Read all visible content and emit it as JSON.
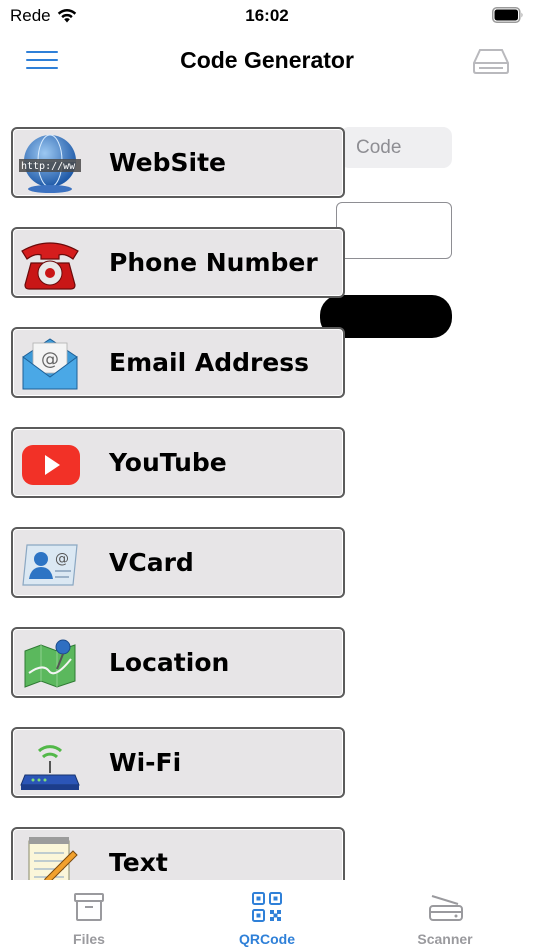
{
  "status_bar": {
    "carrier": "Rede",
    "time": "16:02"
  },
  "nav": {
    "title": "Code Generator",
    "left_icon": "hamburger-menu-icon",
    "right_icon": "drive-icon"
  },
  "background": {
    "segment_label": "Code"
  },
  "menu": {
    "items": [
      {
        "label": "WebSite",
        "icon": "globe-www-icon"
      },
      {
        "label": "Phone Number",
        "icon": "red-telephone-icon"
      },
      {
        "label": "Email Address",
        "icon": "envelope-at-icon"
      },
      {
        "label": "YouTube",
        "icon": "youtube-play-icon"
      },
      {
        "label": "VCard",
        "icon": "contact-card-icon"
      },
      {
        "label": "Location",
        "icon": "map-pin-icon"
      },
      {
        "label": "Wi-Fi",
        "icon": "wifi-router-icon"
      },
      {
        "label": "Text",
        "icon": "notepad-pencil-icon"
      }
    ]
  },
  "tabs": [
    {
      "label": "Files",
      "icon": "archive-box-icon",
      "active": false
    },
    {
      "label": "QRCode",
      "icon": "qr-code-icon",
      "active": true
    },
    {
      "label": "Scanner",
      "icon": "scanner-icon",
      "active": false
    }
  ],
  "colors": {
    "accent": "#2f80d8",
    "inactive": "#9a9a9e",
    "menu_bg": "#e7e5e7",
    "menu_border": "#5b5b5b"
  }
}
